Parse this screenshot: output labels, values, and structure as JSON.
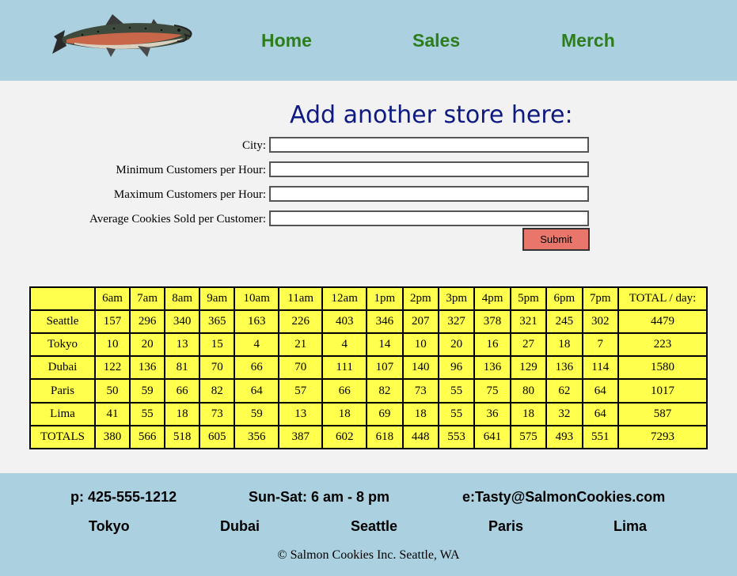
{
  "nav": {
    "home": "Home",
    "sales": "Sales",
    "merch": "Merch"
  },
  "form": {
    "title": "Add another store here:",
    "city_label": "City:",
    "min_label": "Minimum Customers per Hour:",
    "max_label": "Maximum Customers per Hour:",
    "avg_label": "Average Cookies Sold per Customer:",
    "city_value": "",
    "min_value": "",
    "max_value": "",
    "avg_value": "",
    "submit_label": "Submit"
  },
  "table": {
    "headers": [
      "",
      "6am",
      "7am",
      "8am",
      "9am",
      "10am",
      "11am",
      "12am",
      "1pm",
      "2pm",
      "3pm",
      "4pm",
      "5pm",
      "6pm",
      "7pm",
      "TOTAL / day:"
    ],
    "rows": [
      [
        "Seattle",
        "157",
        "296",
        "340",
        "365",
        "163",
        "226",
        "403",
        "346",
        "207",
        "327",
        "378",
        "321",
        "245",
        "302",
        "4479"
      ],
      [
        "Tokyo",
        "10",
        "20",
        "13",
        "15",
        "4",
        "21",
        "4",
        "14",
        "10",
        "20",
        "16",
        "27",
        "18",
        "7",
        "223"
      ],
      [
        "Dubai",
        "122",
        "136",
        "81",
        "70",
        "66",
        "70",
        "111",
        "107",
        "140",
        "96",
        "136",
        "129",
        "136",
        "114",
        "1580"
      ],
      [
        "Paris",
        "50",
        "59",
        "66",
        "82",
        "64",
        "57",
        "66",
        "82",
        "73",
        "55",
        "75",
        "80",
        "62",
        "64",
        "1017"
      ],
      [
        "Lima",
        "41",
        "55",
        "18",
        "73",
        "59",
        "13",
        "18",
        "69",
        "18",
        "55",
        "36",
        "18",
        "32",
        "64",
        "587"
      ],
      [
        "TOTALS",
        "380",
        "566",
        "518",
        "605",
        "356",
        "387",
        "602",
        "618",
        "448",
        "553",
        "641",
        "575",
        "493",
        "551",
        "7293"
      ]
    ]
  },
  "footer": {
    "phone": "p: 425-555-1212",
    "hours": "Sun-Sat: 6 am - 8 pm",
    "email": "e:Tasty@SalmonCookies.com",
    "cities": [
      "Tokyo",
      "Dubai",
      "Seattle",
      "Paris",
      "Lima"
    ],
    "copyright": "© Salmon Cookies Inc. Seattle, WA"
  },
  "colors": {
    "header_bg": "#abd0e0",
    "nav_link": "#2e7d1c",
    "title": "#0e1a82",
    "table_bg": "#ffff4d",
    "submit_bg": "#e8766a"
  },
  "icons": {
    "logo": "salmon-fish-logo"
  }
}
